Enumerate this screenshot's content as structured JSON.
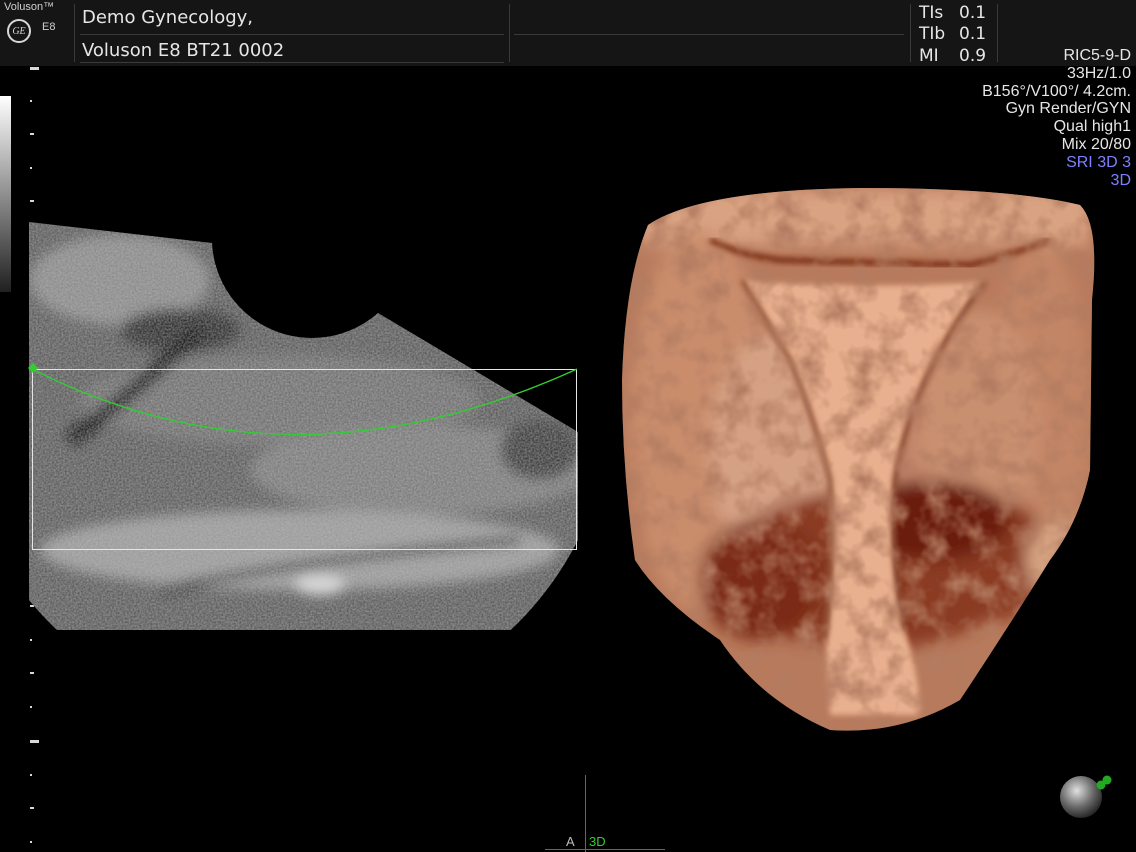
{
  "header": {
    "brand": "Voluson™",
    "logo_text": "GE",
    "model": "E8",
    "patient_line1": "Demo Gynecology,",
    "patient_line2": "Voluson E8 BT21 0002",
    "indices": [
      {
        "label": "TIs",
        "value": "0.1"
      },
      {
        "label": "TIb",
        "value": "0.1"
      },
      {
        "label": "MI",
        "value": "0.9"
      }
    ]
  },
  "parameters": {
    "probe": "RIC5-9-D",
    "frame_rate": "33Hz/1.0",
    "angles": "B156°/V100°/ 4.2cm.",
    "mode": "Gyn Render/GYN",
    "quality": "Qual high1",
    "mix": "Mix 20/80",
    "sri": "SRI 3D 3",
    "view": "3D"
  },
  "colors": {
    "render_curve": "#33cc33",
    "sri_text": "#8080ff",
    "background": "#000000"
  },
  "bottom": {
    "axis_a_label": "A",
    "axis_3d_label": "3D"
  }
}
